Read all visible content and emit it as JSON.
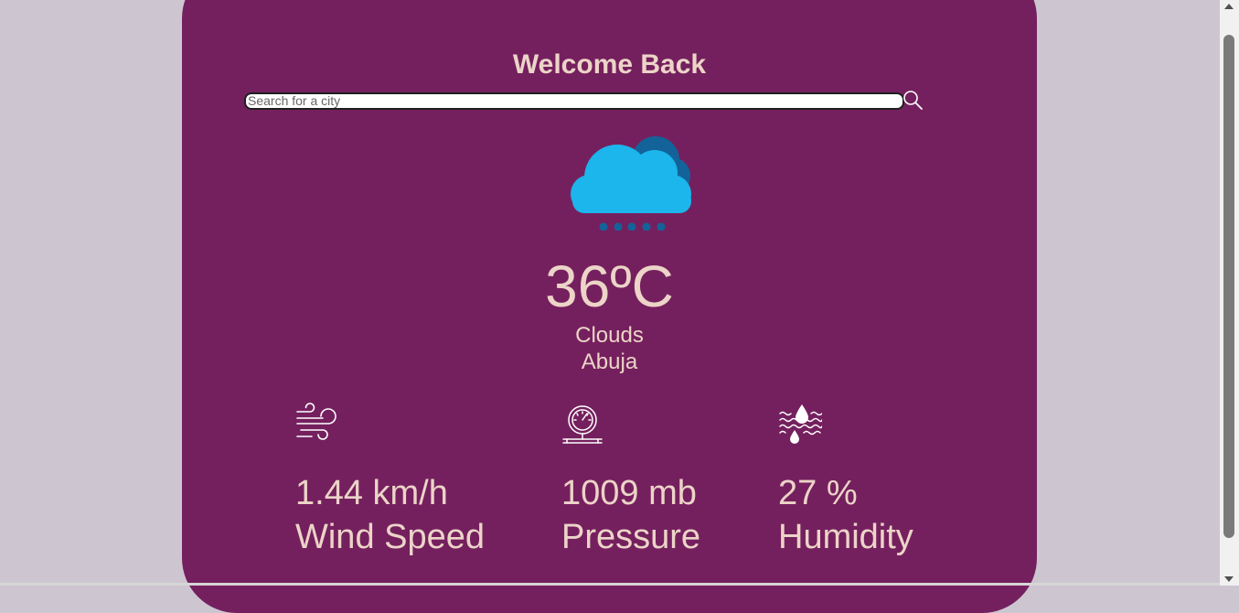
{
  "header": {
    "title": "Welcome Back"
  },
  "search": {
    "placeholder": "Search for a city",
    "value": ""
  },
  "weather": {
    "icon": "rain-cloud-icon",
    "temperature": "36ºC",
    "condition": "Clouds",
    "city": "Abuja"
  },
  "stats": [
    {
      "icon": "wind-icon",
      "value": "1.44 km/h",
      "label": "Wind Speed"
    },
    {
      "icon": "pressure-gauge-icon",
      "value": "1009 mb",
      "label": "Pressure"
    },
    {
      "icon": "humidity-icon",
      "value": "27 %",
      "label": "Humidity"
    }
  ],
  "colors": {
    "page_bg": "#cdc6d1",
    "card_bg": "#75205e",
    "text": "#ecd4c8",
    "cloud_light": "#1cb5ec",
    "cloud_dark": "#13639a"
  }
}
